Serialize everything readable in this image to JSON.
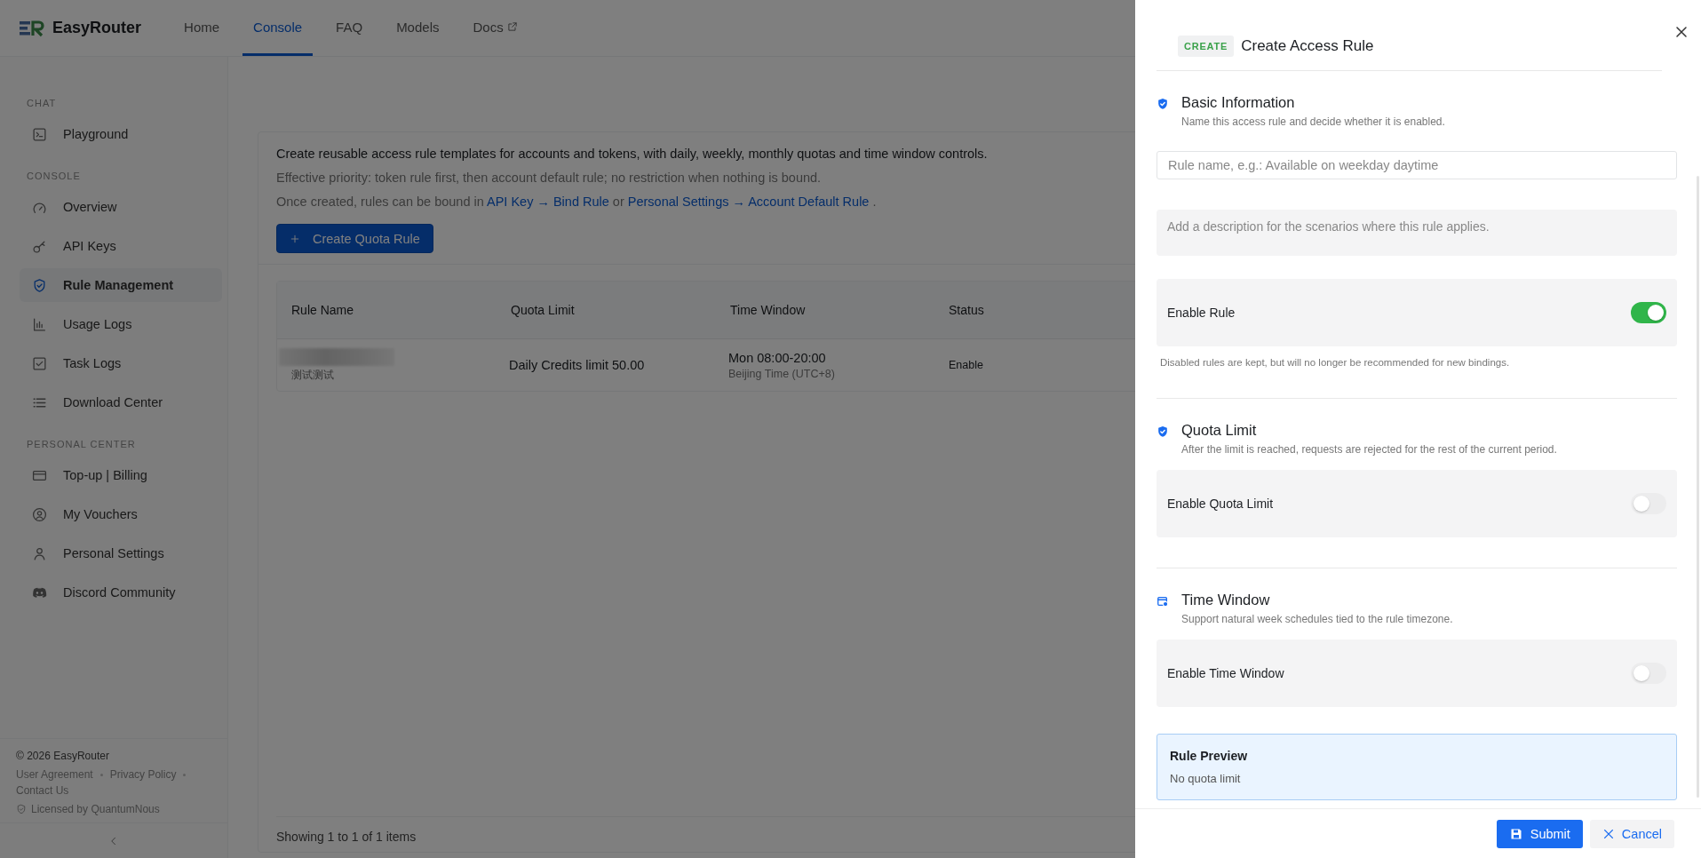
{
  "brand": {
    "name": "EasyRouter"
  },
  "nav": [
    {
      "label": "Home",
      "selected": false,
      "external": false
    },
    {
      "label": "Console",
      "selected": true,
      "external": false
    },
    {
      "label": "FAQ",
      "selected": false,
      "external": false
    },
    {
      "label": "Models",
      "selected": false,
      "external": false
    },
    {
      "label": "Docs",
      "selected": false,
      "external": true
    }
  ],
  "sidebar": {
    "sections": [
      {
        "heading": "CHAT",
        "items": [
          {
            "label": "Playground",
            "selected": false
          }
        ]
      },
      {
        "heading": "CONSOLE",
        "items": [
          {
            "label": "Overview",
            "selected": false
          },
          {
            "label": "API Keys",
            "selected": false
          },
          {
            "label": "Rule Management",
            "selected": true
          },
          {
            "label": "Usage Logs",
            "selected": false
          },
          {
            "label": "Task Logs",
            "selected": false
          },
          {
            "label": "Download Center",
            "selected": false
          }
        ]
      },
      {
        "heading": "PERSONAL CENTER",
        "items": [
          {
            "label": "Top-up | Billing",
            "selected": false
          },
          {
            "label": "My Vouchers",
            "selected": false
          },
          {
            "label": "Personal Settings",
            "selected": false
          },
          {
            "label": "Discord Community",
            "selected": false
          }
        ]
      }
    ],
    "footer": {
      "copyright": "© 2026 EasyRouter",
      "links": [
        "User Agreement",
        "Privacy Policy",
        "Contact Us"
      ],
      "license": "Licensed by QuantumNous"
    }
  },
  "intro": {
    "description": "Create reusable access rule templates for accounts and tokens, with daily, weekly, monthly quotas and time window controls.",
    "priority": "Effective priority: token rule first, then account default rule; no restriction when nothing is bound.",
    "binding": {
      "prefix": "Once created, rules can be bound in",
      "link_1": "API Key → Bind Rule",
      "middle": "or",
      "link_2": "Personal Settings → Account Default Rule",
      "suffix": "."
    }
  },
  "create_button": {
    "label": "Create Quota Rule"
  },
  "table": {
    "columns": [
      "Rule Name",
      "Quota Limit",
      "Time Window",
      "Status"
    ],
    "rows": [
      {
        "rule_name": "测试测试",
        "quota_limit": "Daily Credits limit 50.00",
        "time_window": "Mon 08:00-20:00",
        "timezone": "Beijing Time (UTC+8)",
        "status": "Enable"
      }
    ],
    "summary": "Showing 1 to 1 of 1 items"
  },
  "drawer": {
    "badge": "CREATE",
    "title": "Create Access Rule",
    "basic": {
      "title": "Basic Information",
      "description": "Name this access rule and decide whether it is enabled.",
      "name_placeholder": "Rule name, e.g.: Available on weekday daytime",
      "description_placeholder": "Add a description for the scenarios where this rule applies.",
      "toggle": {
        "label": "Enable Rule",
        "on": true
      },
      "hint": "Disabled rules are kept, but will no longer be recommended for new bindings."
    },
    "quota": {
      "title": "Quota Limit",
      "description": "After the limit is reached, requests are rejected for the rest of the current period.",
      "toggle": {
        "label": "Enable Quota Limit",
        "on": false
      }
    },
    "time_window": {
      "title": "Time Window",
      "description": "Support natural week schedules tied to the rule timezone.",
      "toggle": {
        "label": "Enable Time Window",
        "on": false
      }
    },
    "preview": {
      "title": "Rule Preview",
      "summary": "No quota limit"
    },
    "submit": "Submit",
    "cancel": "Cancel"
  }
}
